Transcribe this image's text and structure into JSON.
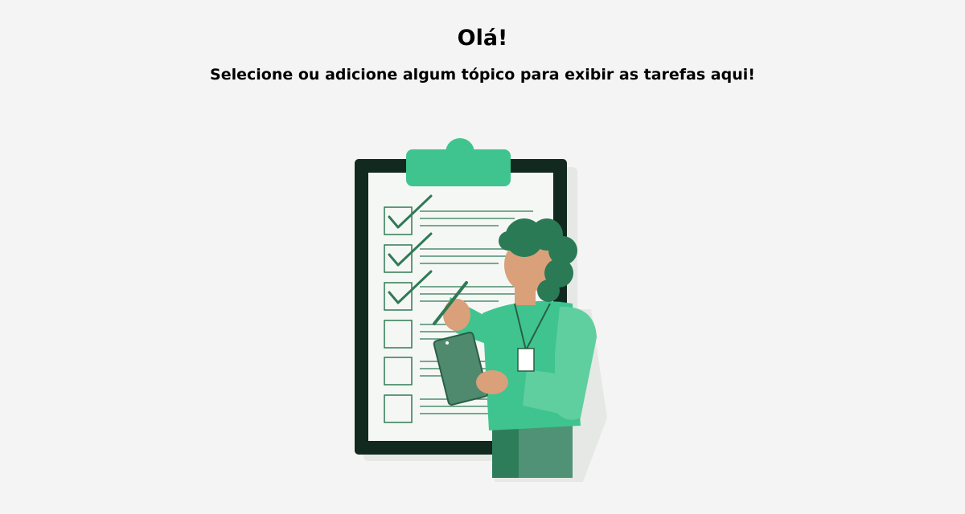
{
  "empty_state": {
    "greeting": "Olá!",
    "message": "Selecione ou adicione algum tópico para exibir as tarefas aqui!"
  },
  "colors": {
    "background": "#f4f4f4",
    "clipboard_frame": "#12291f",
    "clipboard_paper": "#f5f7f5",
    "clip": "#3fc48f",
    "check": "#2f7a55",
    "shirt": "#3fc48f",
    "sleeve": "#5fcf9f",
    "hair": "#2a7a55",
    "skin": "#d9a07a",
    "pants": "#2e7d5a",
    "tablet": "#4f8a6e"
  },
  "illustration": {
    "checklist_items": [
      {
        "checked": true
      },
      {
        "checked": true
      },
      {
        "checked": true
      },
      {
        "checked": false
      },
      {
        "checked": false
      },
      {
        "checked": false
      }
    ]
  }
}
